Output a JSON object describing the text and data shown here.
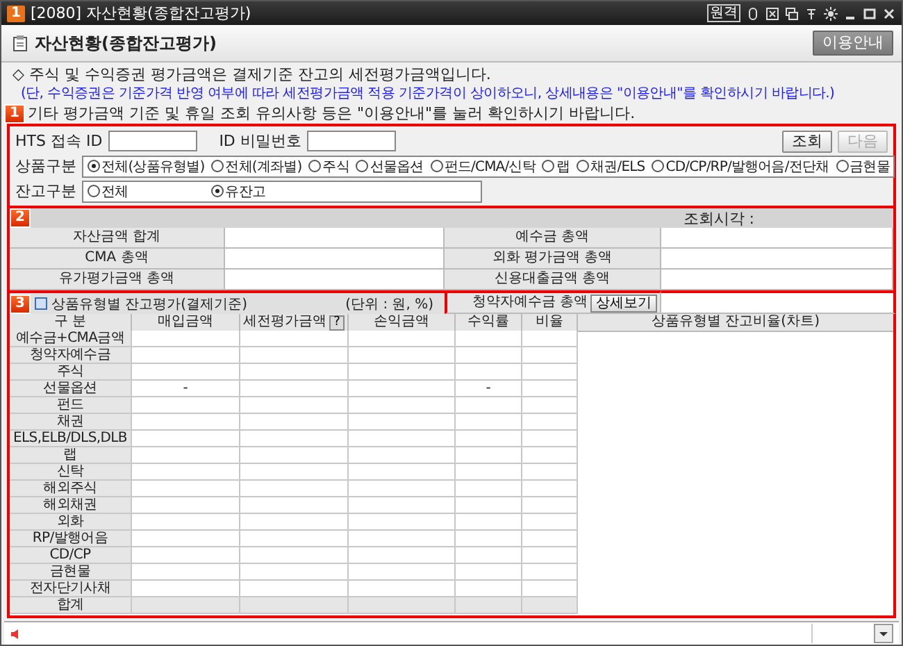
{
  "window": {
    "badge": "1",
    "title": "[2080] 자산현황(종합잔고평가)",
    "remote": "원격"
  },
  "panel": {
    "title": "자산현황(종합잔고평가)",
    "help_button": "이용안내"
  },
  "notes": [
    {
      "kind": "plain",
      "text": "◇ 주식 및 수익증권 평가금액은 결제기준 잔고의 세전평가금액입니다."
    },
    {
      "kind": "info",
      "text": "(단, 수익증권은 기준가격 반영 여부에 따라 세전평가금액 적용 기준가격이 상이하오니, 상세내용은 \"이용안내\"를 확인하시기 바랍니다.)"
    },
    {
      "kind": "plain",
      "text": "기타 평가금액 기준 및 휴일 조회 유의사항 등은 \"이용안내\"를 눌러 확인하시기 바랍니다."
    }
  ],
  "section_badges": [
    "1",
    "2",
    "3"
  ],
  "login": {
    "id_label": "HTS 접속 ID",
    "pw_label": "ID 비밀번호",
    "buttons": [
      {
        "label": "조회",
        "disabled": false
      },
      {
        "label": "다음",
        "disabled": true
      }
    ]
  },
  "product_filter": {
    "label": "상품구분",
    "options": [
      {
        "label": "전체(상품유형별)",
        "selected": true
      },
      {
        "label": "전체(계좌별)",
        "selected": false
      },
      {
        "label": "주식",
        "selected": false
      },
      {
        "label": "선물옵션",
        "selected": false
      },
      {
        "label": "펀드/CMA/신탁",
        "selected": false
      },
      {
        "label": "랩",
        "selected": false
      },
      {
        "label": "채권/ELS",
        "selected": false
      },
      {
        "label": "CD/CP/RP/발행어음/전단채",
        "selected": false
      },
      {
        "label": "금현물",
        "selected": false
      }
    ]
  },
  "balance_filter": {
    "label": "잔고구분",
    "options": [
      {
        "label": "전체",
        "selected": false
      },
      {
        "label": "유잔고",
        "selected": true
      }
    ]
  },
  "summary": {
    "time_label": "조회시각 :",
    "left": [
      "자산금액 합계",
      "CMA 총액",
      "유가평가금액 총액"
    ],
    "right": [
      "예수금 총액",
      "외화 평가금액 총액",
      "신용대출금액 총액",
      "청약자예수금 총액"
    ],
    "detail_button": "상세보기"
  },
  "holdings": {
    "title": "상품유형별 잔고평가(결제기준)",
    "unit": "(단위 : 원, %)",
    "columns": [
      "구 분",
      "매입금액",
      "세전평가금액",
      "손익금액",
      "수익률",
      "비율"
    ],
    "help_button": "?",
    "chart_title": "상품유형별 잔고비율(차트)",
    "rows": [
      {
        "kind": "item",
        "label": "예수금+CMA금액"
      },
      {
        "kind": "item",
        "label": "청약자예수금"
      },
      {
        "kind": "item",
        "label": "주식"
      },
      {
        "kind": "item",
        "label": "선물옵션",
        "purchase": "-",
        "yield": "-"
      },
      {
        "kind": "item",
        "label": "펀드"
      },
      {
        "kind": "item",
        "label": "채권"
      },
      {
        "kind": "item",
        "label": "ELS,ELB/DLS,DLB"
      },
      {
        "kind": "item",
        "label": "랩"
      },
      {
        "kind": "item",
        "label": "신탁"
      },
      {
        "kind": "item",
        "label": "해외주식"
      },
      {
        "kind": "item",
        "label": "해외채권"
      },
      {
        "kind": "item",
        "label": "외화"
      },
      {
        "kind": "item",
        "label": "RP/발행어음"
      },
      {
        "kind": "item",
        "label": "CD/CP"
      },
      {
        "kind": "item",
        "label": "금현물"
      },
      {
        "kind": "item",
        "label": "전자단기사채"
      },
      {
        "kind": "total",
        "label": "합계"
      }
    ]
  }
}
